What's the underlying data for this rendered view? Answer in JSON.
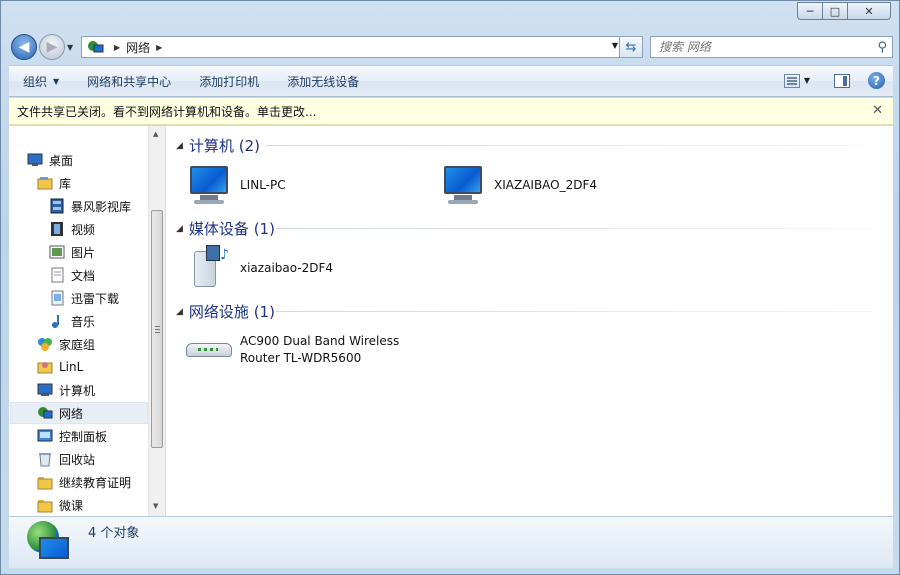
{
  "window": {
    "caption_buttons": [
      "─",
      "□",
      "✕"
    ]
  },
  "address": {
    "location": "网络",
    "search_placeholder": "搜索 网络"
  },
  "commands": {
    "organize": "组织",
    "network_center": "网络和共享中心",
    "add_printer": "添加打印机",
    "add_wireless": "添加无线设备"
  },
  "infobar": {
    "text": "文件共享已关闭。看不到网络计算机和设备。单击更改..."
  },
  "nav": {
    "items": [
      {
        "label": "桌面",
        "icon": "desktop-icon"
      },
      {
        "label": "库",
        "icon": "library-icon"
      },
      {
        "label": "暴风影视库",
        "icon": "video-library-icon"
      },
      {
        "label": "视频",
        "icon": "video-icon"
      },
      {
        "label": "图片",
        "icon": "picture-icon"
      },
      {
        "label": "文档",
        "icon": "document-icon"
      },
      {
        "label": "迅雷下载",
        "icon": "download-icon"
      },
      {
        "label": "音乐",
        "icon": "music-icon"
      },
      {
        "label": "家庭组",
        "icon": "homegroup-icon"
      },
      {
        "label": "LinL",
        "icon": "user-folder-icon"
      },
      {
        "label": "计算机",
        "icon": "computer-icon"
      },
      {
        "label": "网络",
        "icon": "network-icon"
      },
      {
        "label": "控制面板",
        "icon": "control-panel-icon"
      },
      {
        "label": "回收站",
        "icon": "recycle-bin-icon"
      },
      {
        "label": "继续教育证明",
        "icon": "folder-icon"
      },
      {
        "label": "微课",
        "icon": "folder-icon"
      }
    ],
    "selected": "网络"
  },
  "groups": {
    "computers": {
      "title": "计算机 (2)",
      "items": [
        "LINL-PC",
        "XIAZAIBAO_2DF4"
      ]
    },
    "media": {
      "title": "媒体设备 (1)",
      "items": [
        "xiazaibao-2DF4"
      ]
    },
    "infrastructure": {
      "title": "网络设施 (1)",
      "items": [
        "AC900 Dual Band Wireless",
        "Router TL-WDR5600"
      ]
    }
  },
  "status": {
    "count": "4 个对象"
  },
  "colors": {
    "group_header": "#1e3287",
    "infobar_bg": "#ffffe1",
    "frame": "#bcd3ea"
  }
}
